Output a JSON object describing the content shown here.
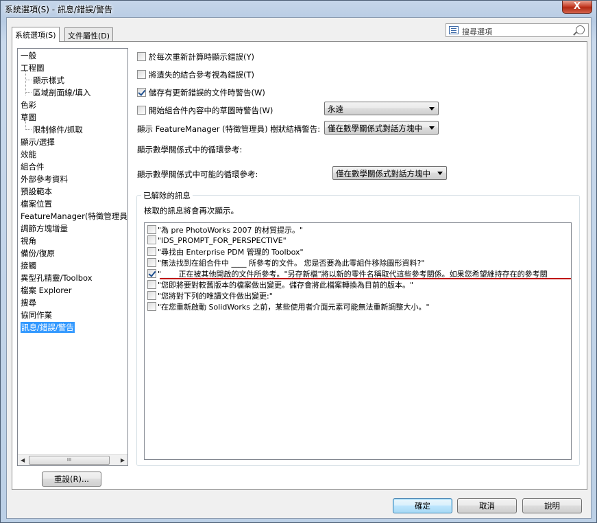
{
  "window": {
    "title": "系統選項(S) - 訊息/錯誤/警告",
    "close_glyph": "X"
  },
  "tabs": [
    {
      "label": "系統選項(S)",
      "active": true
    },
    {
      "label": "文件屬性(D)",
      "active": false
    }
  ],
  "search": {
    "placeholder": "搜尋選項"
  },
  "tree": {
    "items": [
      {
        "label": "一般",
        "level": 0
      },
      {
        "label": "工程圖",
        "level": 0
      },
      {
        "label": "顯示樣式",
        "level": 1
      },
      {
        "label": "區域剖面線/填入",
        "level": 1
      },
      {
        "label": "色彩",
        "level": 0
      },
      {
        "label": "草圖",
        "level": 0
      },
      {
        "label": "限制條件/抓取",
        "level": 1
      },
      {
        "label": "顯示/選擇",
        "level": 0
      },
      {
        "label": "效能",
        "level": 0
      },
      {
        "label": "組合件",
        "level": 0
      },
      {
        "label": "外部參考資料",
        "level": 0
      },
      {
        "label": "預設範本",
        "level": 0
      },
      {
        "label": "檔案位置",
        "level": 0
      },
      {
        "label": "FeatureManager(特徵管理員",
        "level": 0
      },
      {
        "label": "調節方塊增量",
        "level": 0
      },
      {
        "label": "視角",
        "level": 0
      },
      {
        "label": "備份/復原",
        "level": 0
      },
      {
        "label": "接觸",
        "level": 0
      },
      {
        "label": "異型孔精靈/Toolbox",
        "level": 0
      },
      {
        "label": "檔案 Explorer",
        "level": 0
      },
      {
        "label": "搜尋",
        "level": 0
      },
      {
        "label": "協同作業",
        "level": 0
      },
      {
        "label": "訊息/錯誤/警告",
        "level": 0,
        "selected": true
      }
    ],
    "scroll_thumb_glyph": "III"
  },
  "reset_button": "重設(R)...",
  "options": {
    "opt1": {
      "label": "於每次重新計算時顯示錯誤(Y)",
      "checked": false
    },
    "opt2": {
      "label": "將遺失的結合參考視為錯誤(T)",
      "checked": false
    },
    "opt3": {
      "label": "儲存有更新錯誤的文件時警告(W)",
      "checked": true
    },
    "opt4": {
      "label": "開始組合件內容中的草圖時警告(W)",
      "checked": false,
      "combo": "永遠"
    },
    "fm_label": "顯示 FeatureManager (特徵管理員) 樹狀結構警告:",
    "fm_combo": "僅在數學關係式對話方塊中",
    "circ_label": "顯示數學關係式中的循環參考:",
    "possible_circ_label": "顯示數學關係式中可能的循環參考:",
    "possible_circ_combo": "僅在數學關係式對話方塊中"
  },
  "dismissed": {
    "title": "已解除的訊息",
    "description": "核取的訊息將會再次顯示。",
    "messages": [
      {
        "text": "\"為 pre PhotoWorks 2007 的材質提示。\"",
        "checked": false
      },
      {
        "text": "\"IDS_PROMPT_FOR_PERSPECTIVE\"",
        "checked": false
      },
      {
        "text": "\"尋找由 Enterprise PDM 管理的 Toolbox\"",
        "checked": false
      },
      {
        "text": "\"無法找到在組合件中 ____ 所參考的文件。 您是否要為此零組件移除圖形資料?\"",
        "checked": false
      },
      {
        "text": "\"____ 正在被其他開啟的文件所參考。\"另存新檔\"將以新的零件名稱取代這些參考關係。如果您希望維持存在的參考關",
        "checked": true
      },
      {
        "text": "\"您即將要對較舊版本的檔案做出變更。儲存會將此檔案轉換為目前的版本。\"",
        "checked": false
      },
      {
        "text": "\"您將對下列的唯讀文件做出變更:\"",
        "checked": false
      },
      {
        "text": "\"在您重新啟動 SolidWorks 之前，某些使用者介面元素可能無法重新調整大小。\"",
        "checked": false
      }
    ]
  },
  "footer": {
    "ok": "確定",
    "cancel": "取消",
    "help": "說明"
  }
}
